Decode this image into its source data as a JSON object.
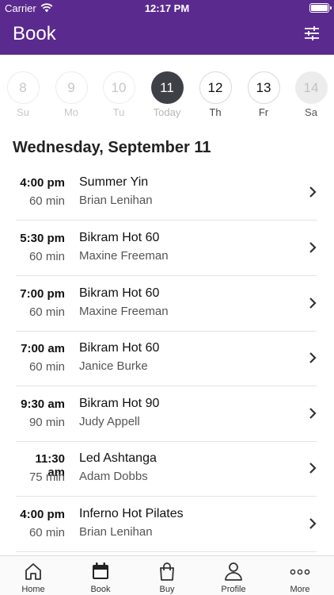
{
  "status_bar": {
    "carrier": "Carrier",
    "time": "12:17 PM"
  },
  "header": {
    "title": "Book"
  },
  "days": [
    {
      "num": "8",
      "label": "Su",
      "state": "past"
    },
    {
      "num": "9",
      "label": "Mo",
      "state": "past"
    },
    {
      "num": "10",
      "label": "Tu",
      "state": "past"
    },
    {
      "num": "11",
      "label": "Today",
      "state": "today"
    },
    {
      "num": "12",
      "label": "Th",
      "state": "future"
    },
    {
      "num": "13",
      "label": "Fr",
      "state": "future"
    },
    {
      "num": "14",
      "label": "Sa",
      "state": "disabled"
    }
  ],
  "date_heading": "Wednesday, September 11",
  "classes": [
    {
      "time": "4:00 pm",
      "duration": "60 min",
      "name": "Summer Yin",
      "teacher": "Brian Lenihan"
    },
    {
      "time": "5:30 pm",
      "duration": "60 min",
      "name": "Bikram Hot 60",
      "teacher": "Maxine Freeman"
    },
    {
      "time": "7:00 pm",
      "duration": "60 min",
      "name": "Bikram Hot 60",
      "teacher": "Maxine Freeman"
    },
    {
      "time": "7:00 am",
      "duration": "60 min",
      "name": "Bikram Hot 60",
      "teacher": "Janice Burke"
    },
    {
      "time": "9:30 am",
      "duration": "90 min",
      "name": "Bikram Hot 90",
      "teacher": "Judy Appell"
    },
    {
      "time": "11:30 am",
      "duration": "75 min",
      "name": "Led Ashtanga",
      "teacher": "Adam Dobbs"
    },
    {
      "time": "4:00 pm",
      "duration": "60 min",
      "name": "Inferno Hot Pilates",
      "teacher": "Brian Lenihan"
    }
  ],
  "tabs": [
    {
      "label": "Home",
      "icon": "home-icon",
      "active": false
    },
    {
      "label": "Book",
      "icon": "calendar-icon",
      "active": true
    },
    {
      "label": "Buy",
      "icon": "shopping-bag-icon",
      "active": false
    },
    {
      "label": "Profile",
      "icon": "person-icon",
      "active": false
    },
    {
      "label": "More",
      "icon": "more-dots-icon",
      "active": false
    }
  ],
  "colors": {
    "header_bg": "#5b2a8e",
    "today_circle": "#3f3f47"
  }
}
